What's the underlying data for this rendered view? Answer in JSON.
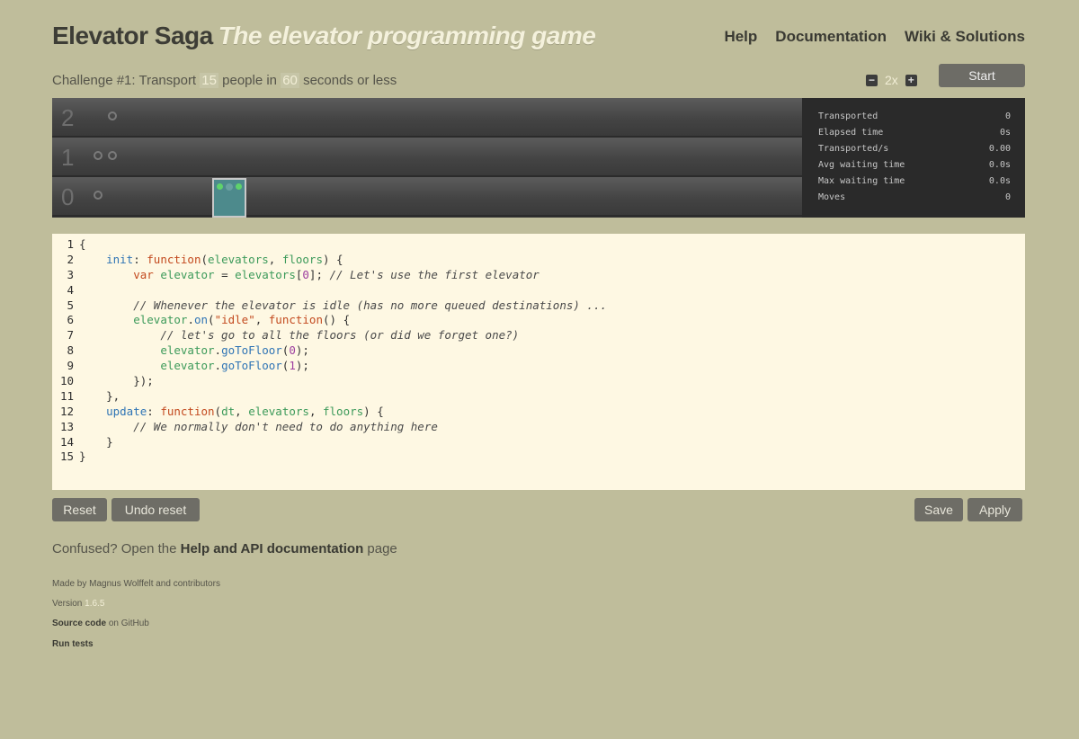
{
  "header": {
    "title": "Elevator Saga",
    "subtitle": "The elevator programming game",
    "nav": [
      "Help",
      "Documentation",
      "Wiki & Solutions"
    ]
  },
  "challenge": {
    "prefix": "Challenge #1: Transport",
    "people": "15",
    "mid": "people in",
    "seconds": "60",
    "suffix": "seconds or less"
  },
  "controls": {
    "speed": "2x",
    "minus_icon": "minus-icon",
    "plus_icon": "plus-icon",
    "start_label": "Start"
  },
  "world": {
    "floors": [
      "2",
      "1",
      "0"
    ],
    "elevator_indicators": "two green indicators lit"
  },
  "stats": [
    {
      "label": "Transported",
      "value": "0"
    },
    {
      "label": "Elapsed time",
      "value": "0s"
    },
    {
      "label": "Transported/s",
      "value": "0.00"
    },
    {
      "label": "Avg waiting time",
      "value": "0.0s"
    },
    {
      "label": "Max waiting time",
      "value": "0.0s"
    },
    {
      "label": "Moves",
      "value": "0"
    }
  ],
  "code_lines": [
    "{",
    "    init: function(elevators, floors) {",
    "        var elevator = elevators[0]; // Let's use the first elevator",
    "",
    "        // Whenever the elevator is idle (has no more queued destinations) ...",
    "        elevator.on(\"idle\", function() {",
    "            // let's go to all the floors (or did we forget one?)",
    "            elevator.goToFloor(0);",
    "            elevator.goToFloor(1);",
    "        });",
    "    },",
    "    update: function(dt, elevators, floors) {",
    "        // We normally don't need to do anything here",
    "    }",
    "}"
  ],
  "buttons": {
    "reset": "Reset",
    "undo_reset": "Undo reset",
    "save": "Save",
    "apply": "Apply"
  },
  "help": {
    "prefix": "Confused? Open the",
    "link": "Help and API documentation",
    "suffix": "page"
  },
  "footer": {
    "made_by": "Made by Magnus Wolffelt and contributors",
    "version_label": "Version",
    "version": "1.6.5",
    "source_link": "Source code",
    "source_suffix": "on GitHub",
    "run_tests": "Run tests"
  }
}
